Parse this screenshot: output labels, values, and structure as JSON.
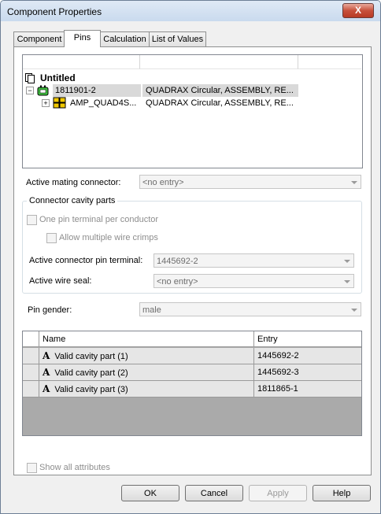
{
  "window": {
    "title": "Component Properties",
    "close_glyph": "X"
  },
  "tabs": [
    {
      "label": "Component"
    },
    {
      "label": "Pins"
    },
    {
      "label": "Calculation"
    },
    {
      "label": "List of Values"
    }
  ],
  "tree": {
    "root_label": "Untitled",
    "rows": [
      {
        "expander": "−",
        "name": "1811901-2",
        "desc": "QUADRAX Circular, ASSEMBLY, RE..."
      },
      {
        "expander": "+",
        "name": "AMP_QUAD4S...",
        "desc": "QUADRAX Circular, ASSEMBLY, RE..."
      }
    ]
  },
  "mating": {
    "label": "Active mating connector:",
    "value": "<no entry>"
  },
  "cavity_group": {
    "title": "Connector cavity parts",
    "one_pin_label": "One pin terminal per conductor",
    "allow_multiple_label": "Allow multiple wire crimps",
    "pin_terminal_label": "Active connector pin terminal:",
    "pin_terminal_value": "1445692-2",
    "wire_seal_label": "Active wire seal:",
    "wire_seal_value": "<no entry>"
  },
  "gender": {
    "label": "Pin gender:",
    "value": "male"
  },
  "grid": {
    "headers": {
      "name": "Name",
      "entry": "Entry"
    },
    "row_icon": "A",
    "rows": [
      {
        "name": "Valid cavity part (1)",
        "entry": "1445692-2"
      },
      {
        "name": "Valid cavity part (2)",
        "entry": "1445692-3"
      },
      {
        "name": "Valid cavity part (3)",
        "entry": "1811865-1"
      }
    ]
  },
  "show_all_label": "Show all attributes",
  "buttons": {
    "ok": "OK",
    "cancel": "Cancel",
    "apply": "Apply",
    "help": "Help"
  }
}
